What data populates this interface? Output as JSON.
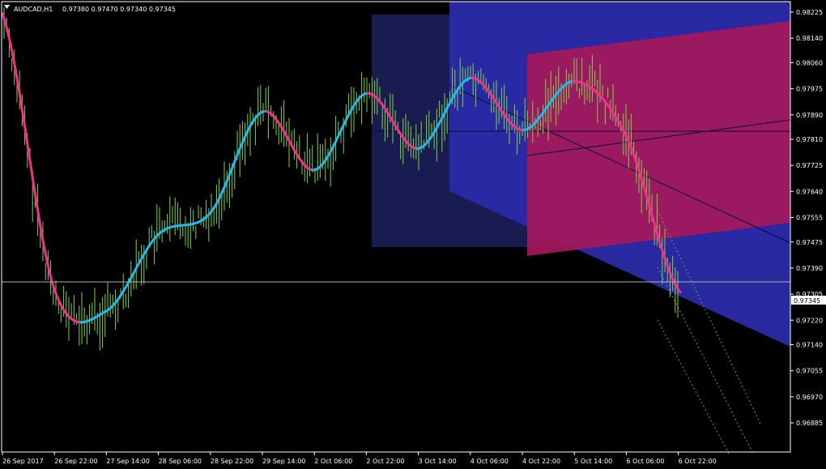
{
  "header": {
    "symbol": "AUDCAD,H1",
    "ohlc": "0.97380 0.97470 0.97340 0.97345"
  },
  "current_price_label": "0.97345",
  "colors": {
    "background": "#000000",
    "bars": "#7fd43a",
    "ma_up": "#22b8f0",
    "ma_down": "#f0308c",
    "pitchfork": "#2a2aa8",
    "channel": "#b01a60",
    "rectangle": "#191c50",
    "axis_text": "#ffffff"
  },
  "chart_data": {
    "type": "line",
    "title": "AUDCAD,H1",
    "timeframe": "H1",
    "ylim": [
      0.9685,
      0.9825
    ],
    "y_ticks": [
      "0.98225",
      "0.98140",
      "0.98060",
      "0.97975",
      "0.97890",
      "0.97810",
      "0.97725",
      "0.97640",
      "0.97555",
      "0.97475",
      "0.97390",
      "0.97305",
      "0.97220",
      "0.97140",
      "0.97055",
      "0.96970",
      "0.96885"
    ],
    "x_ticks": [
      "26 Sep 2017",
      "26 Sep 22:00",
      "27 Sep 14:00",
      "28 Sep 06:00",
      "28 Sep 22:00",
      "29 Sep 14:00",
      "2 Oct 06:00",
      "2 Oct 22:00",
      "3 Oct 14:00",
      "4 Oct 06:00",
      "4 Oct 22:00",
      "5 Oct 14:00",
      "6 Oct 06:00",
      "6 Oct 22:00"
    ],
    "current_price": 0.97345,
    "last_bar": {
      "open": 0.9738,
      "high": 0.9747,
      "low": 0.9734,
      "close": 0.97345
    },
    "series": [
      {
        "x": [
          "26 Sep 2017",
          "26 Sep 22:00",
          "27 Sep 14:00",
          "28 Sep 06:00",
          "28 Sep 22:00",
          "29 Sep 14:00",
          "2 Oct 06:00",
          "2 Oct 22:00",
          "3 Oct 14:00",
          "4 Oct 06:00",
          "4 Oct 22:00",
          "5 Oct 14:00",
          "6 Oct 06:00",
          "6 Oct 22:00"
        ],
        "values": [
          0.9822,
          0.9732,
          0.9725,
          0.975,
          0.9757,
          0.979,
          0.9771,
          0.9796,
          0.9778,
          0.9801,
          0.9784,
          0.98,
          0.9782,
          0.9732
        ]
      }
    ]
  }
}
